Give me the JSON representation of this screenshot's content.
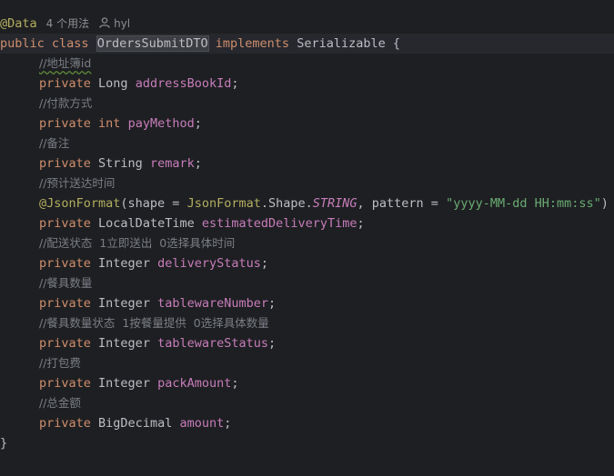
{
  "code": {
    "line1": {
      "annotation": "@Data",
      "usages": "4 个用法",
      "author": "hyl",
      "author_icon": "user-icon"
    },
    "line2": {
      "kw1": "public",
      "kw2": "class",
      "class_name": "OrdersSubmitDTO",
      "kw3": "implements",
      "iface": "Serializable",
      "brace": "{"
    },
    "c_address": "//地址簿id",
    "f_address": {
      "kw": "private",
      "type": "Long",
      "name": "addressBookId",
      "semi": ";"
    },
    "c_pay": "//付款方式",
    "f_pay": {
      "kw": "private",
      "type": "int",
      "name": "payMethod",
      "semi": ";"
    },
    "c_remark": "//备注",
    "f_remark": {
      "kw": "private",
      "type": "String",
      "name": "remark",
      "semi": ";"
    },
    "c_est": "//预计送达时间",
    "anno_json": {
      "at": "@JsonFormat",
      "open": "(shape = ",
      "cls": "JsonFormat",
      "dot": ".Shape.",
      "const": "STRING",
      "mid": ", pattern = ",
      "pattern": "\"yyyy-MM-dd HH:mm:ss\"",
      "close": ")"
    },
    "f_est": {
      "kw": "private",
      "type": "LocalDateTime",
      "name": "estimatedDeliveryTime",
      "semi": ";"
    },
    "c_delivery": "//配送状态  1立即送出  0选择具体时间",
    "f_delivery": {
      "kw": "private",
      "type": "Integer",
      "name": "deliveryStatus",
      "semi": ";"
    },
    "c_tw_num": "//餐具数量",
    "f_tw_num": {
      "kw": "private",
      "type": "Integer",
      "name": "tablewareNumber",
      "semi": ";"
    },
    "c_tw_status": "//餐具数量状态  1按餐量提供  0选择具体数量",
    "f_tw_status": {
      "kw": "private",
      "type": "Integer",
      "name": "tablewareStatus",
      "semi": ";"
    },
    "c_pack": "//打包费",
    "f_pack": {
      "kw": "private",
      "type": "Integer",
      "name": "packAmount",
      "semi": ";"
    },
    "c_amount": "//总金额",
    "f_amount": {
      "kw": "private",
      "type": "BigDecimal",
      "name": "amount",
      "semi": ";"
    },
    "closing": "}"
  }
}
